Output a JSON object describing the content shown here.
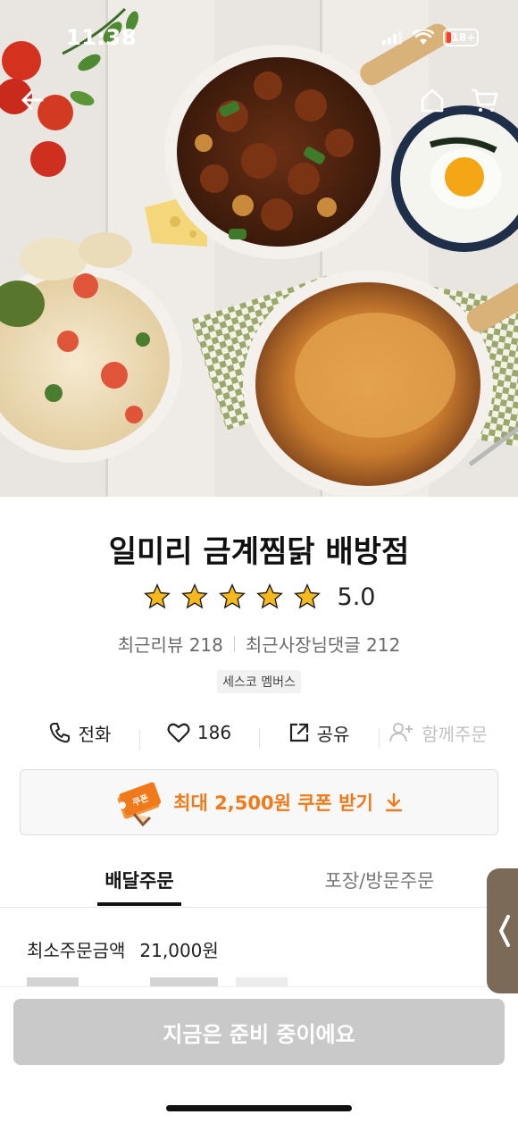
{
  "status_bar": {
    "time": "11:38",
    "battery": "18+"
  },
  "nav": {
    "back_icon": "arrow-left-icon",
    "home_icon": "home-icon",
    "cart_icon": "cart-icon"
  },
  "store": {
    "name": "일미리 금계찜닭 배방점",
    "rating": "5.0",
    "stars": 5,
    "recent_reviews": "최근리뷰 218",
    "owner_replies": "최근사장님댓글 212",
    "badge": "세스코 멤버스"
  },
  "actions": [
    {
      "label": "전화",
      "icon": "phone-icon"
    },
    {
      "label": "186",
      "icon": "heart-icon"
    },
    {
      "label": "공유",
      "icon": "share-icon"
    },
    {
      "label": "함께주문",
      "icon": "add-person-icon"
    }
  ],
  "coupon": {
    "label": "최대 2,500원 쿠폰 받기",
    "ticket_text": "쿠폰"
  },
  "tabs": {
    "delivery": "배달주문",
    "pickup": "포장/방문주문"
  },
  "order_info": {
    "min_order_label": "최소주문금액",
    "min_order_value": "21,000원"
  },
  "order_button": "지금은 준비 중이에요",
  "colors": {
    "accent": "#f07a1a",
    "star": "#f6b91d",
    "disabled": "#c9c9c9"
  }
}
